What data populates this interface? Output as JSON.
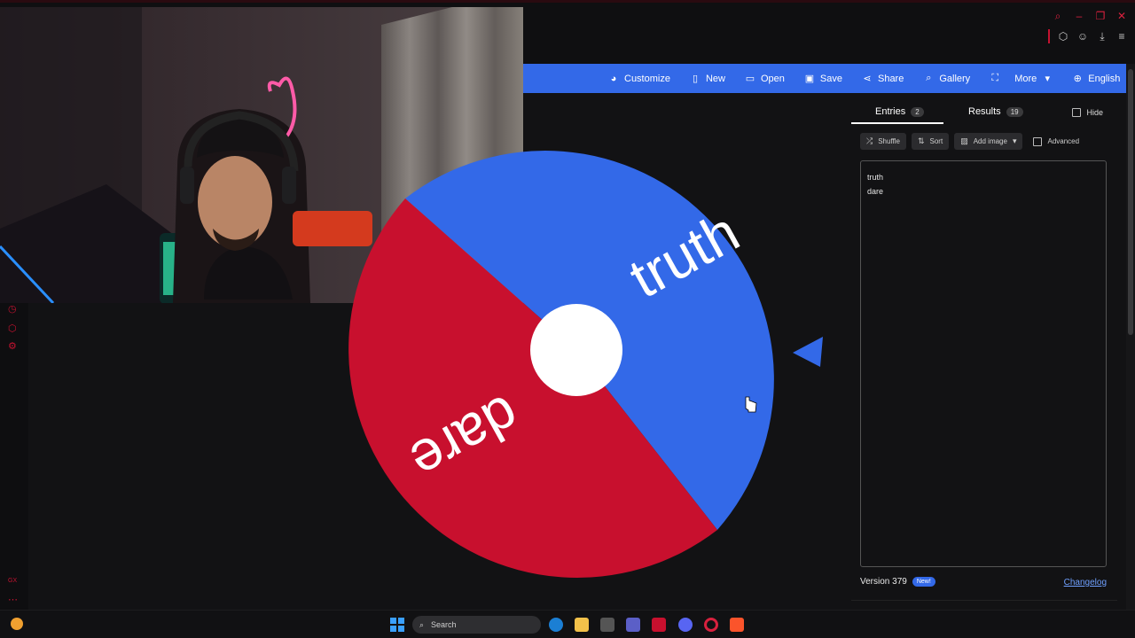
{
  "navbar": {
    "customize": "Customize",
    "new": "New",
    "open": "Open",
    "save": "Save",
    "share": "Share",
    "gallery": "Gallery",
    "more": "More",
    "language": "English"
  },
  "wheel": {
    "segments": [
      {
        "label": "truth",
        "color": "#3369e8"
      },
      {
        "label": "dare",
        "color": "#c8102e"
      }
    ],
    "pointer_color": "#3369e8",
    "hub_color": "#ffffff"
  },
  "panel": {
    "tab_entries": "Entries",
    "entries_count": "2",
    "tab_results": "Results",
    "results_count": "19",
    "hide_label": "Hide",
    "shuffle": "Shuffle",
    "sort": "Sort",
    "add_image": "Add image",
    "advanced": "Advanced",
    "entries": [
      "truth",
      "dare"
    ],
    "version": "Version 379",
    "new_badge": "New!",
    "changelog": "Changelog"
  },
  "taskbar": {
    "search_placeholder": "Search"
  },
  "sidebar": {
    "bottom_label": "GX"
  }
}
